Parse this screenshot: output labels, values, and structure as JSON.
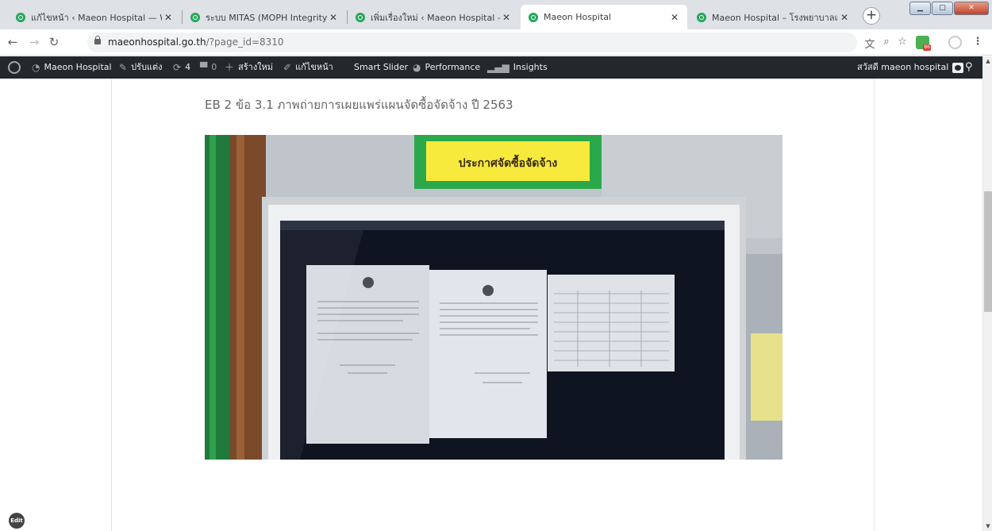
{
  "browser": {
    "tabs": [
      {
        "label": "แก้ไขหน้า ‹ Maeon Hospital — W",
        "active": false
      },
      {
        "label": "ระบบ MITAS (MOPH Integrity and",
        "active": false
      },
      {
        "label": "เพิ่มเรื่องใหม่ ‹ Maeon Hospital — W",
        "active": false
      },
      {
        "label": "Maeon Hospital",
        "active": true
      },
      {
        "label": "Maeon Hospital – โรงพยาบาลแม่",
        "active": false
      }
    ],
    "url_host": "maeonhospital.go.th",
    "url_path": "/?page_id=8310"
  },
  "adminbar": {
    "site_name": "Maeon Hospital",
    "customize": "ปรับแต่ง",
    "updates": "4",
    "comments": "0",
    "new": "สร้างใหม่",
    "edit_page": "แก้ไขหน้า",
    "smart_slider": "Smart Slider",
    "performance": "Performance",
    "insights": "Insights",
    "greeting": "สวัสดี maeon hospital"
  },
  "content": {
    "caption": "EB 2 ข้อ 3.1 ภาพถ่ายการเผยแพร่แผนจัดซื้อจัดจ้าง ปี 2563",
    "photo_sign": "ประกาศจัดซื้อจัดจ้าง"
  },
  "edit_button": "Edit",
  "colors": {
    "tabstrip": "#dee1e6",
    "adminbar": "#23282d",
    "favicon": "#26a65b",
    "sign_background": "#f7ea3c",
    "sign_frame": "#2aa84a"
  }
}
